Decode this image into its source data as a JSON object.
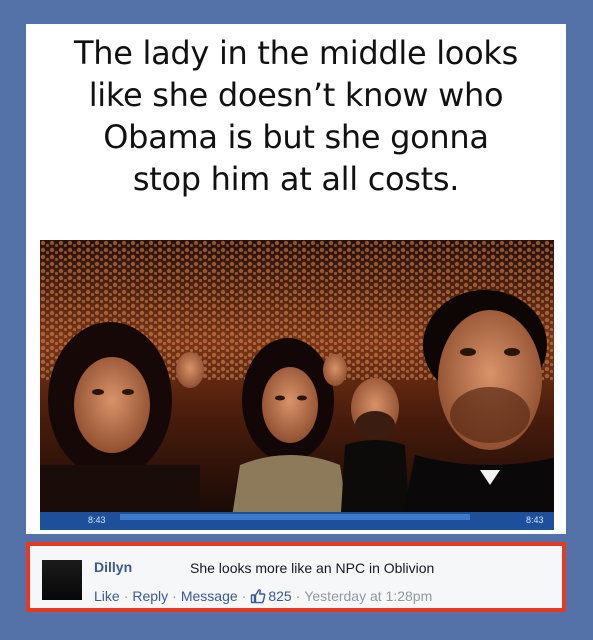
{
  "post": {
    "caption_lines": [
      "The lady in the middle looks",
      "like she doesn’t know who",
      "Obama is but she gonna",
      "stop him at all costs."
    ],
    "photo_timestamps": [
      "8:43",
      "8:43"
    ]
  },
  "comment": {
    "author": "Dillyn",
    "text": "She looks more like an NPC in Oblivion",
    "actions": {
      "like": "Like",
      "reply": "Reply",
      "message": "Message",
      "like_count": "825",
      "timestamp": "Yesterday at 1:28pm"
    },
    "highlight_color": "#e23a24"
  },
  "colors": {
    "background": "#5471a8",
    "link": "#3b5998"
  },
  "icons": [
    "thumbs-up-icon"
  ]
}
